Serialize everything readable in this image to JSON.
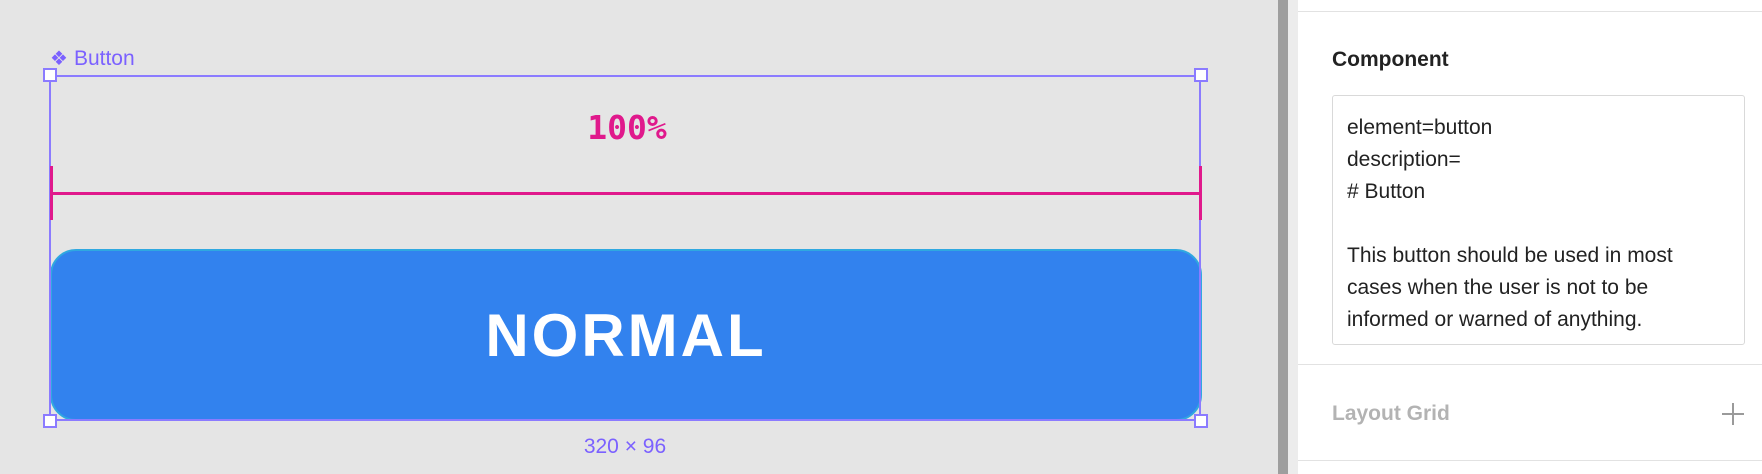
{
  "canvas": {
    "frame_label": "Button",
    "frame_icon": "component-icon",
    "measure_value": "100%",
    "button_text": "NORMAL",
    "dimensions": "320 × 96",
    "colors": {
      "selection": "#8b7bff",
      "measure": "#e0198c",
      "button_fill": "#3282ee",
      "button_stroke": "#2fa8e0",
      "canvas_bg": "#e5e5e5"
    }
  },
  "inspector": {
    "component_title": "Component",
    "component_text": "element=button\ndescription=\n# Button\n\nThis button should be used in most cases when the user is not to be informed or warned of anything.",
    "layout_grid_title": "Layout Grid",
    "add_icon": "plus-icon"
  }
}
